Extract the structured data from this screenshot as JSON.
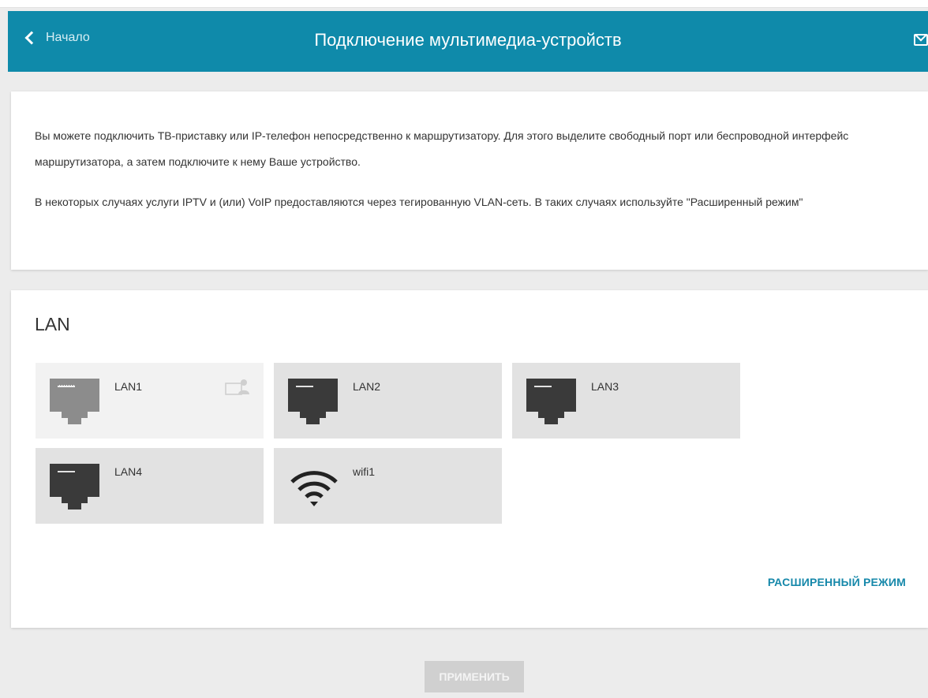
{
  "header": {
    "back_label": "Начало",
    "title": "Подключение мультимедиа-устройств",
    "mail_icon": "envelope-icon",
    "color": "#0f8aaa"
  },
  "info": {
    "paragraph1": "Вы можете подключить ТВ-приставку или IP-телефон непосредственно к маршрутизатору. Для этого выделите свободный порт или беспроводной интерфейс маршрутизатора, а затем подключите к нему Ваше устройство.",
    "paragraph2": "В некоторых случаях услуги IPTV и (или) VoIP предоставляются через тегированную VLAN-сеть. В таких случаях используйте \"Расширенный режим\""
  },
  "lan": {
    "title": "LAN",
    "interfaces": [
      {
        "label": "LAN1",
        "icon": "ethernet-port-icon",
        "state": "assigned",
        "badge_icon": "device-assigned-icon"
      },
      {
        "label": "LAN2",
        "icon": "ethernet-port-icon",
        "state": "available"
      },
      {
        "label": "LAN3",
        "icon": "ethernet-port-icon",
        "state": "available"
      },
      {
        "label": "LAN4",
        "icon": "ethernet-port-icon",
        "state": "available"
      },
      {
        "label": "wifi1",
        "icon": "wifi-icon",
        "state": "available"
      }
    ],
    "advanced_mode_label": "РАСШИРЕННЫЙ РЕЖИМ"
  },
  "actions": {
    "apply_label": "ПРИМЕНИТЬ",
    "apply_enabled": false
  },
  "colors": {
    "accent": "#1688aa",
    "tile_bg": "#e2e2e2",
    "tile_disabled_bg": "#f2f2f2",
    "port_dark": "#3a3a3a",
    "port_light": "#8c8c8c"
  }
}
